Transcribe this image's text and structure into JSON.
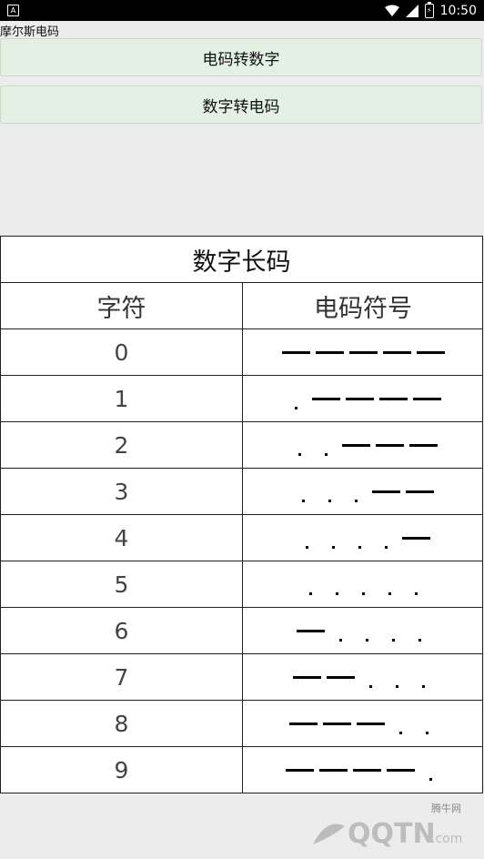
{
  "status": {
    "time": "10:50",
    "notif_glyph": "A",
    "battery_glyph": "⚡"
  },
  "app_title": "摩尔斯电码",
  "buttons": {
    "to_number": "电码转数字",
    "to_code": "数字转电码"
  },
  "table": {
    "title": "数字长码",
    "headers": {
      "char": "字符",
      "code": "电码符号"
    },
    "rows": [
      {
        "char": "0",
        "code": "-----"
      },
      {
        "char": "1",
        "code": ".----"
      },
      {
        "char": "2",
        "code": "..---"
      },
      {
        "char": "3",
        "code": "...--"
      },
      {
        "char": "4",
        "code": "....-"
      },
      {
        "char": "5",
        "code": "....."
      },
      {
        "char": "6",
        "code": "-...."
      },
      {
        "char": "7",
        "code": "--..."
      },
      {
        "char": "8",
        "code": "---.."
      },
      {
        "char": "9",
        "code": "----."
      }
    ]
  },
  "watermark": {
    "top": "腾牛网",
    "main": "QQTN",
    "suffix": ".com"
  }
}
